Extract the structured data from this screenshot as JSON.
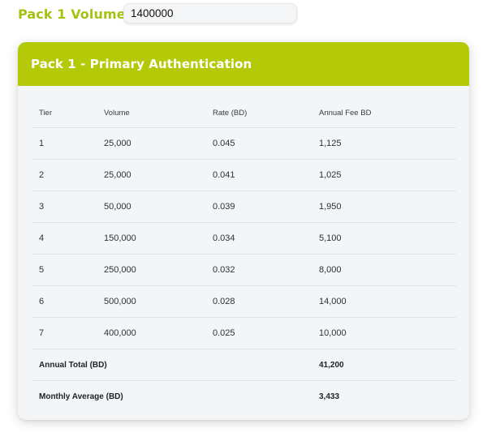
{
  "pack_volume": {
    "label": "Pack 1 Volume:",
    "value": "1400000"
  },
  "card": {
    "title": "Pack 1 - Primary Authentication",
    "columns": [
      "Tier",
      "Volume",
      "Rate (BD)",
      "Annual Fee BD"
    ],
    "rows": [
      {
        "tier": "1",
        "volume": "25,000",
        "rate": "0.045",
        "fee": "1,125"
      },
      {
        "tier": "2",
        "volume": "25,000",
        "rate": "0.041",
        "fee": "1,025"
      },
      {
        "tier": "3",
        "volume": "50,000",
        "rate": "0.039",
        "fee": "1,950"
      },
      {
        "tier": "4",
        "volume": "150,000",
        "rate": "0.034",
        "fee": "5,100"
      },
      {
        "tier": "5",
        "volume": "250,000",
        "rate": "0.032",
        "fee": "8,000"
      },
      {
        "tier": "6",
        "volume": "500,000",
        "rate": "0.028",
        "fee": "14,000"
      },
      {
        "tier": "7",
        "volume": "400,000",
        "rate": "0.025",
        "fee": "10,000"
      }
    ],
    "annual_total": {
      "label": "Annual Total (BD)",
      "value": "41,200"
    },
    "monthly_average": {
      "label": "Monthly Average (BD)",
      "value": "3,433"
    }
  },
  "colors": {
    "accent": "#b4ca08",
    "label_green": "#a7c111",
    "card_bg": "#f3f5f7"
  }
}
